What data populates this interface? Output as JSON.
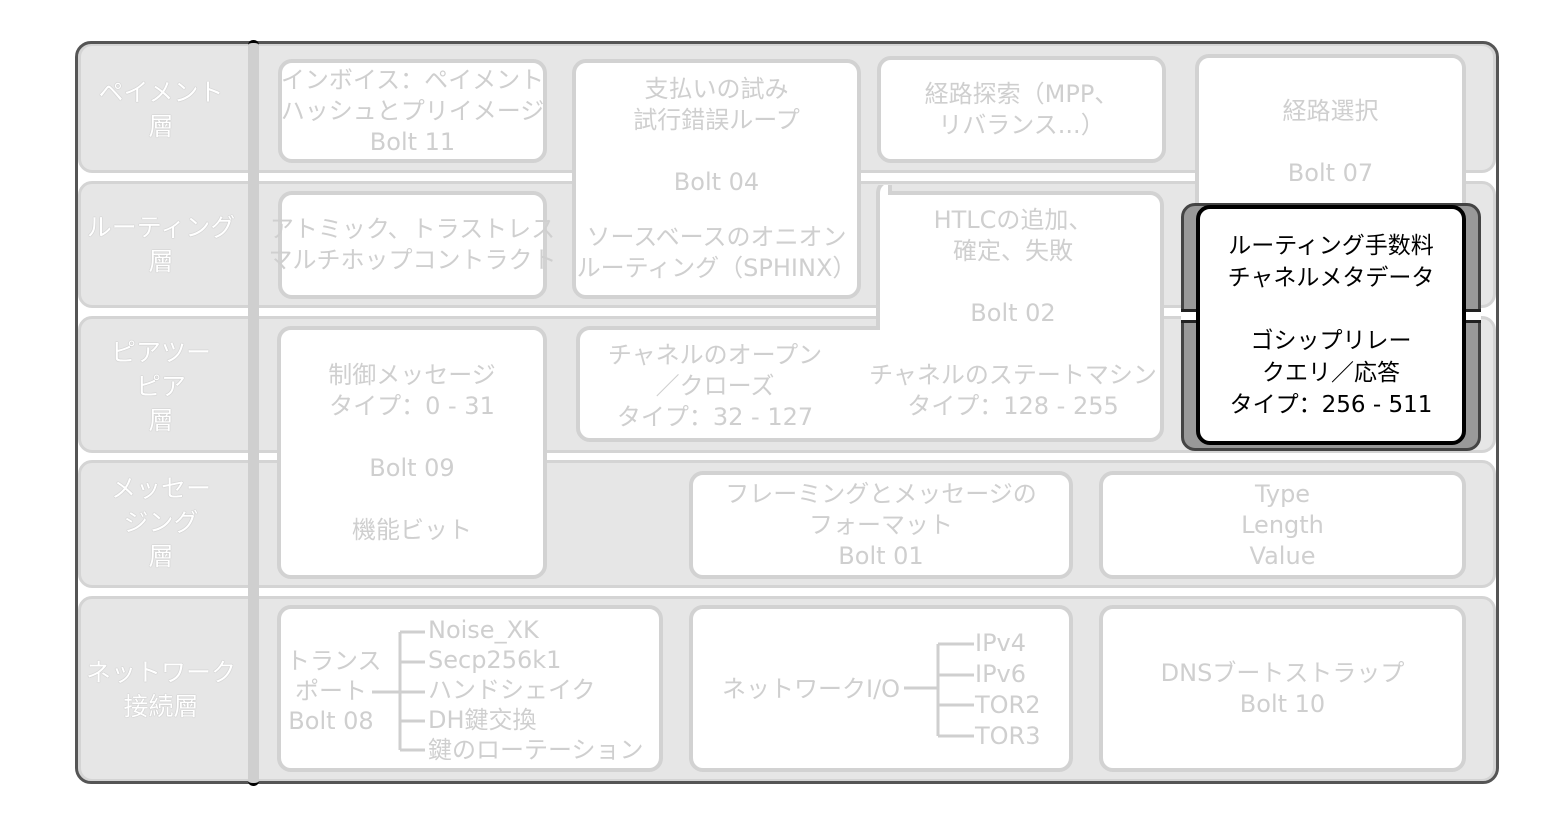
{
  "layers": [
    {
      "line1": "ペイメント",
      "line2": "層"
    },
    {
      "line1": "ルーティング",
      "line2": "層"
    },
    {
      "line1": "ピアツー",
      "line2": "ピア",
      "line3": "層"
    },
    {
      "line1": "メッセー",
      "line2": "ジング",
      "line3": "層"
    },
    {
      "line1": "ネットワーク",
      "line2": "接続層"
    }
  ],
  "boxes": {
    "invoice": [
      "インボイス：ペイメント",
      "ハッシュとプリイメージ",
      "Bolt 11"
    ],
    "payment_attempt": [
      "支払いの試み",
      "試行錯誤ループ",
      "Bolt 04",
      "ソースベースのオニオン",
      "ルーティング（SPHINX）"
    ],
    "pathfinding": [
      "経路探索（MPP、",
      "リバランス...）"
    ],
    "route_selection": [
      "経路選択",
      "Bolt 07"
    ],
    "atomic": [
      "アトミック、トラストレス",
      "マルチホップコントラクト"
    ],
    "htlc": [
      "HTLCの追加、",
      "確定、失敗",
      "Bolt 02",
      "チャネルのステートマシン",
      "タイプ：128 - 255"
    ],
    "channel_open": [
      "チャネルのオープン",
      "／クローズ",
      "タイプ：32 - 127"
    ],
    "control": [
      "制御メッセージ",
      "タイプ：0 - 31",
      "Bolt 09",
      "機能ビット"
    ],
    "framing": [
      "フレーミングとメッセージの",
      "フォーマット",
      "Bolt 01"
    ],
    "tlv": [
      "Type",
      "Length",
      "Value"
    ],
    "transport": {
      "label": [
        "トランス",
        "ポート",
        "Bolt 08"
      ],
      "items": [
        "Noise_XK",
        "Secp256k1",
        "ハンドシェイク",
        "DH鍵交換",
        "鍵のローテーション"
      ]
    },
    "network_io": {
      "label": "ネットワークI/O",
      "items": [
        "IPv4",
        "IPv6",
        "TOR2",
        "TOR3"
      ]
    },
    "dns": [
      "DNSブートストラップ",
      "Bolt 10"
    ],
    "highlight": [
      "ルーティング手数料",
      "チャネルメタデータ",
      "ゴシップリレー",
      "クエリ／応答",
      "タイプ：256 - 511"
    ]
  },
  "colors": {
    "highlight_text": "#000000",
    "faded_text": "#cfcfcf",
    "layer_bg": "#e6e6e6"
  }
}
